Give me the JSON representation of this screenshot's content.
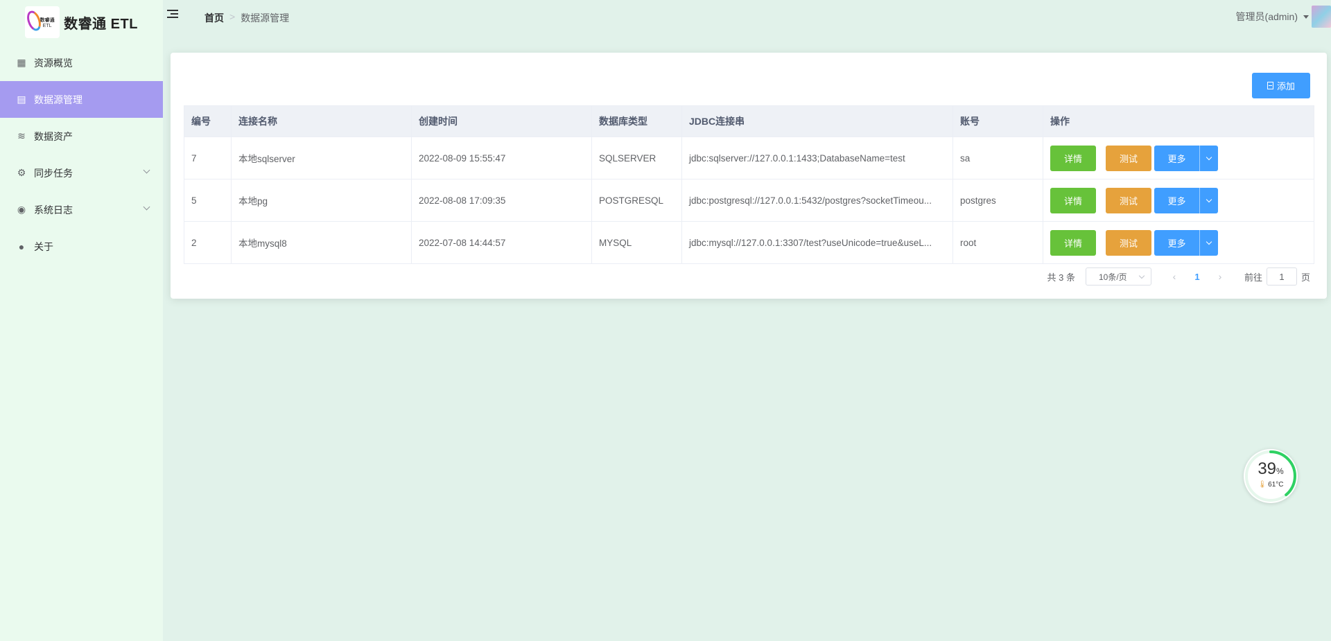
{
  "app": {
    "logo_line1": "数睿通",
    "logo_line2": "ETL",
    "title": "数睿通 ETL"
  },
  "sidebar": {
    "items": [
      {
        "label": "资源概览",
        "icon": "grid-icon",
        "active": false,
        "expandable": false
      },
      {
        "label": "数据源管理",
        "icon": "clipboard-icon",
        "active": true,
        "expandable": false
      },
      {
        "label": "数据资产",
        "icon": "database-icon",
        "active": false,
        "expandable": false
      },
      {
        "label": "同步任务",
        "icon": "gear-icon",
        "active": false,
        "expandable": true
      },
      {
        "label": "系统日志",
        "icon": "log-icon",
        "active": false,
        "expandable": true
      },
      {
        "label": "关于",
        "icon": "user-icon",
        "active": false,
        "expandable": false
      }
    ]
  },
  "header": {
    "breadcrumb_home": "首页",
    "breadcrumb_current": "数据源管理",
    "user": "管理员(admin)"
  },
  "toolbar": {
    "add_label": "添加"
  },
  "table": {
    "columns": [
      "编号",
      "连接名称",
      "创建时间",
      "数据库类型",
      "JDBC连接串",
      "账号",
      "操作"
    ],
    "rows": [
      {
        "id": "7",
        "name": "本地sqlserver",
        "created": "2022-08-09 15:55:47",
        "db_type": "SQLSERVER",
        "jdbc": "jdbc:sqlserver://127.0.0.1:1433;DatabaseName=test",
        "account": "sa"
      },
      {
        "id": "5",
        "name": "本地pg",
        "created": "2022-08-08 17:09:35",
        "db_type": "POSTGRESQL",
        "jdbc": "jdbc:postgresql://127.0.0.1:5432/postgres?socketTimeou...",
        "account": "postgres"
      },
      {
        "id": "2",
        "name": "本地mysql8",
        "created": "2022-07-08 14:44:57",
        "db_type": "MYSQL",
        "jdbc": "jdbc:mysql://127.0.0.1:3307/test?useUnicode=true&useL...",
        "account": "root"
      }
    ],
    "actions": {
      "detail": "详情",
      "test": "测试",
      "more": "更多"
    }
  },
  "pagination": {
    "total": "共 3 条",
    "page_size": "10条/页",
    "current_page": "1",
    "goto_prefix": "前往",
    "goto_value": "1",
    "goto_suffix": "页"
  },
  "monitor": {
    "percent": "39",
    "percent_sign": "%",
    "percent_value": 39,
    "temperature": "61°C"
  },
  "colors": {
    "primary": "#409eff",
    "success": "#67c23a",
    "warning": "#e6a23c",
    "sidebar_active": "#a59bf0",
    "gauge": "#2fd163"
  }
}
